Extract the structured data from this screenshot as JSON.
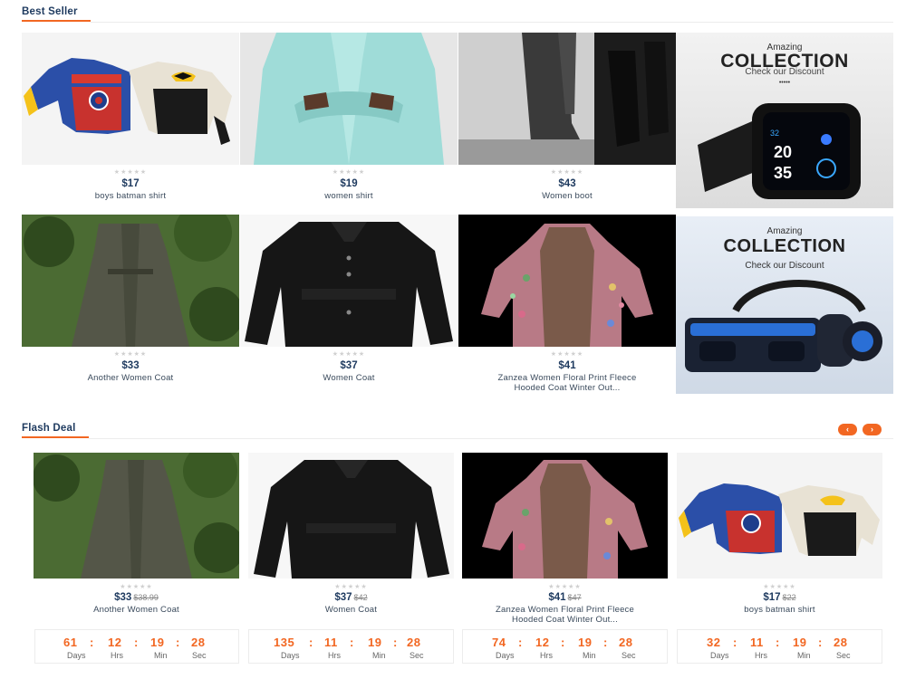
{
  "best_seller": {
    "title": "Best Seller",
    "products": [
      {
        "price": "$17",
        "name": "boys batman shirt",
        "stars": "★★★★★",
        "image": "kids-superhero-sweater"
      },
      {
        "price": "$19",
        "name": "women shirt",
        "stars": "★★★★★",
        "image": "mint-shirt"
      },
      {
        "price": "$43",
        "name": "Women boot",
        "stars": "★★★★★",
        "image": "black-knee-boots"
      },
      {
        "price": "$33",
        "name": "Another Women Coat",
        "stars": "★★★★★",
        "image": "olive-trench-coat"
      },
      {
        "price": "$37",
        "name": "Women Coat",
        "stars": "★★★★★",
        "image": "black-belted-coat"
      },
      {
        "price": "$41",
        "name": "Zanzea Women Floral Print Fleece Hooded Coat Winter Out...",
        "stars": "★★★★★",
        "image": "floral-hooded-coat"
      }
    ],
    "banners": [
      {
        "line1": "Amazing",
        "line2": "COLLECTION",
        "line3": "Check our Discount",
        "line4": "•••••",
        "image": "smartwatch-icon",
        "watch_time": "20",
        "watch_min": "35"
      },
      {
        "line1": "Amazing",
        "line2": "COLLECTION",
        "line3": "Check our Discount",
        "image": "vr-headset-icon"
      }
    ]
  },
  "flash_deal": {
    "title": "Flash Deal",
    "prev_arrow": "‹",
    "next_arrow": "›",
    "timer_labels": {
      "days": "Days",
      "hrs": "Hrs",
      "min": "Min",
      "sec": "Sec"
    },
    "colon": ":",
    "products": [
      {
        "price": "$33",
        "old_price": "$38.99",
        "name": "Another Women Coat",
        "stars": "★★★★★",
        "timer": {
          "days": "61",
          "hrs": "12",
          "min": "19",
          "sec": "28"
        }
      },
      {
        "price": "$37",
        "old_price": "$42",
        "name": "Women Coat",
        "stars": "★★★★★",
        "timer": {
          "days": "135",
          "hrs": "11",
          "min": "19",
          "sec": "28"
        }
      },
      {
        "price": "$41",
        "old_price": "$47",
        "name": "Zanzea Women Floral Print Fleece Hooded Coat Winter Out...",
        "stars": "★★★★★",
        "timer": {
          "days": "74",
          "hrs": "12",
          "min": "19",
          "sec": "28"
        }
      },
      {
        "price": "$17",
        "old_price": "$22",
        "name": "boys batman shirt",
        "stars": "★★★★★",
        "timer": {
          "days": "32",
          "hrs": "11",
          "min": "19",
          "sec": "28"
        }
      }
    ]
  },
  "colors": {
    "accent": "#f26722",
    "heading": "#1e3a5f",
    "star": "#d0d0d0"
  }
}
